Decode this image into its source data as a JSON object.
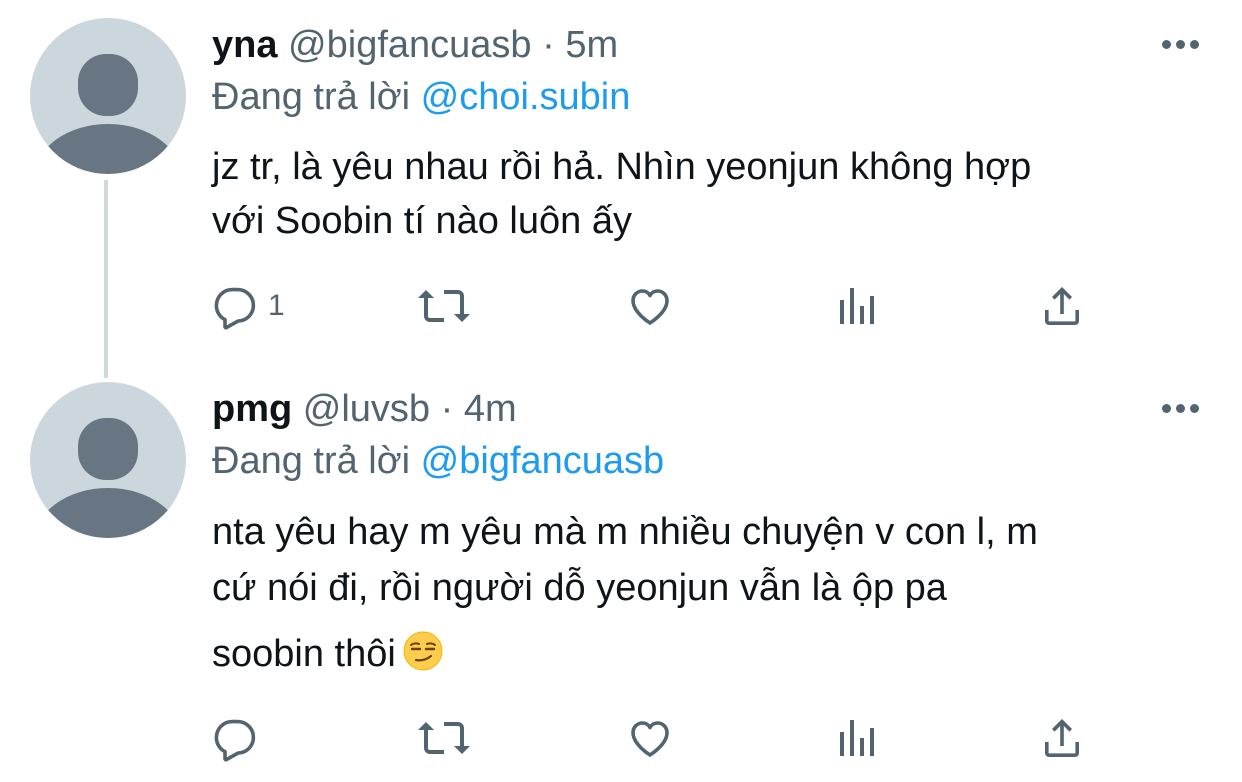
{
  "tweets": [
    {
      "name": "yna",
      "handle": "@bigfancuasb",
      "separator": "·",
      "time": "5m",
      "replying_prefix": "Đang trả lời",
      "replying_to": "@choi.subin",
      "text_lines": [
        "jz tr, là yêu nhau rồi hả. Nhìn yeonjun không hợp",
        "với Soobin tí nào luôn ấy"
      ],
      "reply_count": "1",
      "icons": [
        "reply-icon",
        "retweet-icon",
        "like-icon",
        "analytics-icon",
        "share-icon",
        "more-icon"
      ]
    },
    {
      "name": "pmg",
      "handle": "@luvsb",
      "separator": "·",
      "time": "4m",
      "replying_prefix": "Đang trả lời",
      "replying_to": "@bigfancuasb",
      "text_lines": [
        "nta yêu hay m yêu mà m nhiều chuyện v con l, m",
        "cứ nói đi, rồi người dỗ yeonjun vẫn là ộp pa",
        "soobin thôi"
      ],
      "emoji": "smirking-face-emoji",
      "reply_count": "",
      "icons": [
        "reply-icon",
        "retweet-icon",
        "like-icon",
        "analytics-icon",
        "share-icon",
        "more-icon"
      ]
    }
  ],
  "colors": {
    "text": "#0f1419",
    "secondary": "#536471",
    "mention": "#1d9bf0",
    "avatar_bg": "#ccd6dd",
    "avatar_fg": "#687684",
    "thread_line": "#cfd9de"
  }
}
